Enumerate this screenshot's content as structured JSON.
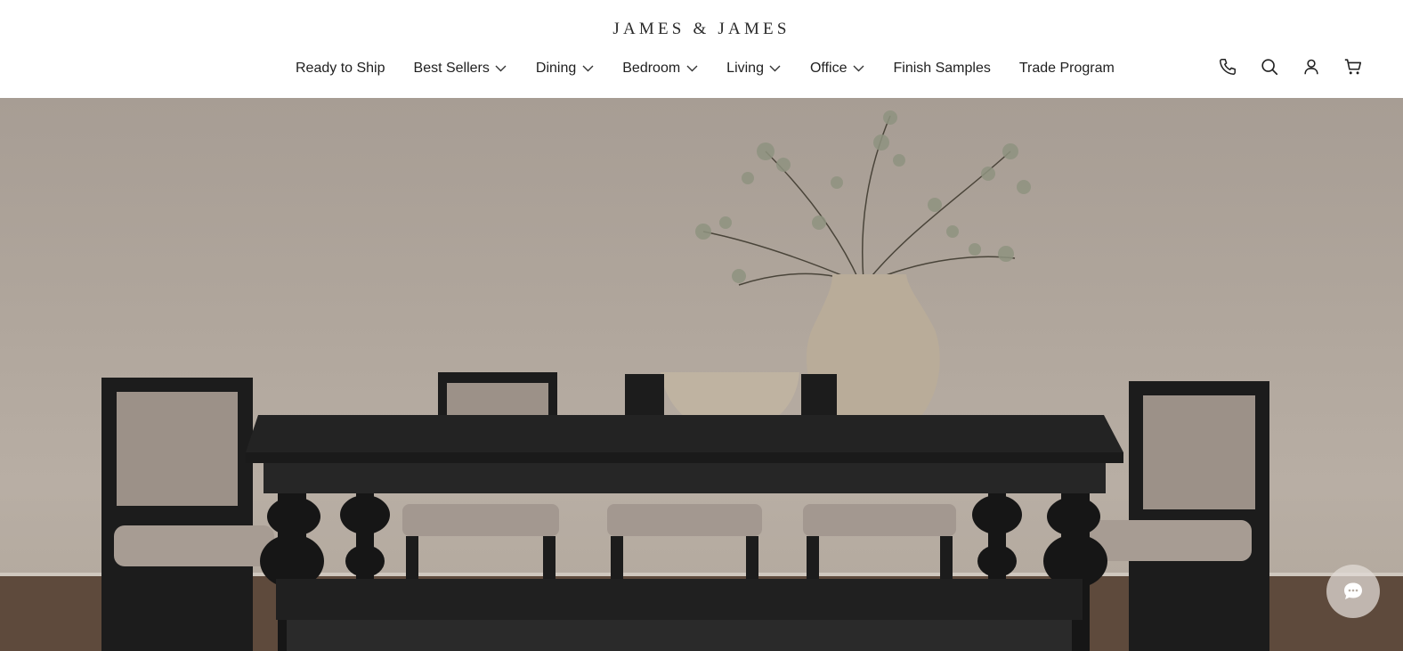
{
  "brand": {
    "logo_text": "JAMES & JAMES"
  },
  "nav": {
    "items": [
      {
        "label": "Ready to Ship",
        "has_dropdown": false
      },
      {
        "label": "Best Sellers",
        "has_dropdown": true
      },
      {
        "label": "Dining",
        "has_dropdown": true
      },
      {
        "label": "Bedroom",
        "has_dropdown": true
      },
      {
        "label": "Living",
        "has_dropdown": true
      },
      {
        "label": "Office",
        "has_dropdown": true
      },
      {
        "label": "Finish Samples",
        "has_dropdown": false
      },
      {
        "label": "Trade Program",
        "has_dropdown": false
      }
    ]
  },
  "header_icons": [
    "phone-icon",
    "search-icon",
    "account-icon",
    "cart-icon"
  ],
  "hero": {
    "image": "dining-room-table-with-chairs-and-vase"
  },
  "chat": {
    "icon": "chat-bubble-icon"
  },
  "colors": {
    "text": "#1f1f1f",
    "background": "#ffffff",
    "wall": "#b0a69c",
    "furniture": "#1e1e1e"
  }
}
